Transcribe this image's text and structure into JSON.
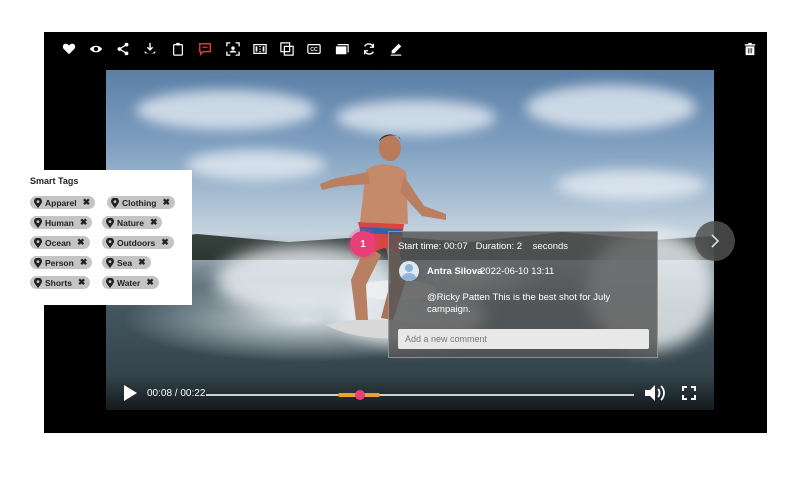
{
  "toolbar": {
    "icons": [
      "heart-icon",
      "eye-icon",
      "share-icon",
      "download-icon",
      "clipboard-icon",
      "comment-icon",
      "scan-icon",
      "film-icon",
      "copy-icon",
      "caption-icon",
      "layers-icon",
      "refresh-icon",
      "pencil-icon"
    ],
    "active_icon": "comment-icon",
    "active_color": "#e8352f",
    "trash": "trash-icon"
  },
  "player": {
    "time_current": "00:08",
    "time_total": "00:22",
    "time_display": "00:08 / 00:22",
    "progress": 0.36
  },
  "marker": {
    "label": "1",
    "color": "#e83f78"
  },
  "comment": {
    "start_label": "Start time: 00:07",
    "duration_label": "Duration: 2",
    "duration_unit": "seconds",
    "author": "Antra Silova",
    "date": "2022-06-10 13:11",
    "body": "@Ricky Patten This is the best shot for July campaign.",
    "input_placeholder": "Add a new comment"
  },
  "smart_tags": {
    "title": "Smart Tags",
    "items": [
      "Apparel",
      "Clothing",
      "Human",
      "Nature",
      "Ocean",
      "Outdoors",
      "Person",
      "Sea",
      "Shorts",
      "Water"
    ]
  }
}
